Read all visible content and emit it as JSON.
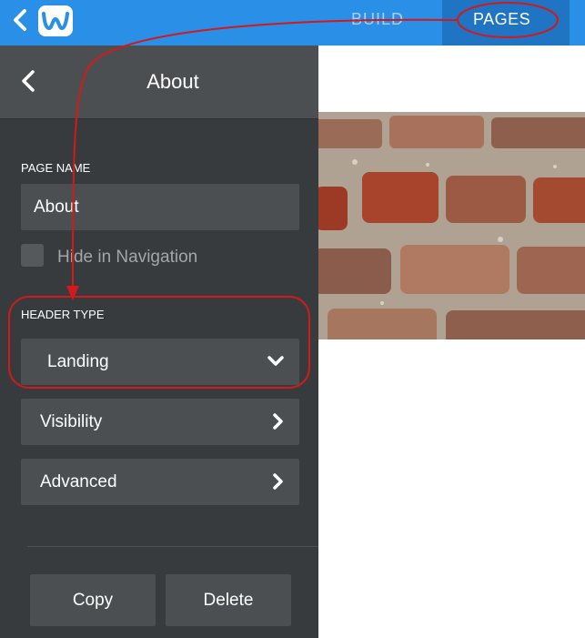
{
  "topbar": {
    "back_icon": "chevron-left-icon",
    "logo_icon": "weebly-w-logo",
    "tabs": [
      {
        "label": "BUILD",
        "active": false
      },
      {
        "label": "PAGES",
        "active": true
      }
    ],
    "accent_color": "#2a8fe6"
  },
  "panel": {
    "back_icon": "chevron-left-icon",
    "title": "About",
    "page_name_label": "PAGE NAME",
    "page_name_value": "About",
    "hide_in_nav_label": "Hide in Navigation",
    "hide_in_nav_checked": false,
    "header_type_label": "HEADER TYPE",
    "header_type_value": "Landing",
    "visibility_label": "Visibility",
    "advanced_label": "Advanced",
    "copy_label": "Copy",
    "delete_label": "Delete"
  },
  "preview": {
    "image": "brick-wall-header-image"
  },
  "annotation_color": "#d21a1a"
}
